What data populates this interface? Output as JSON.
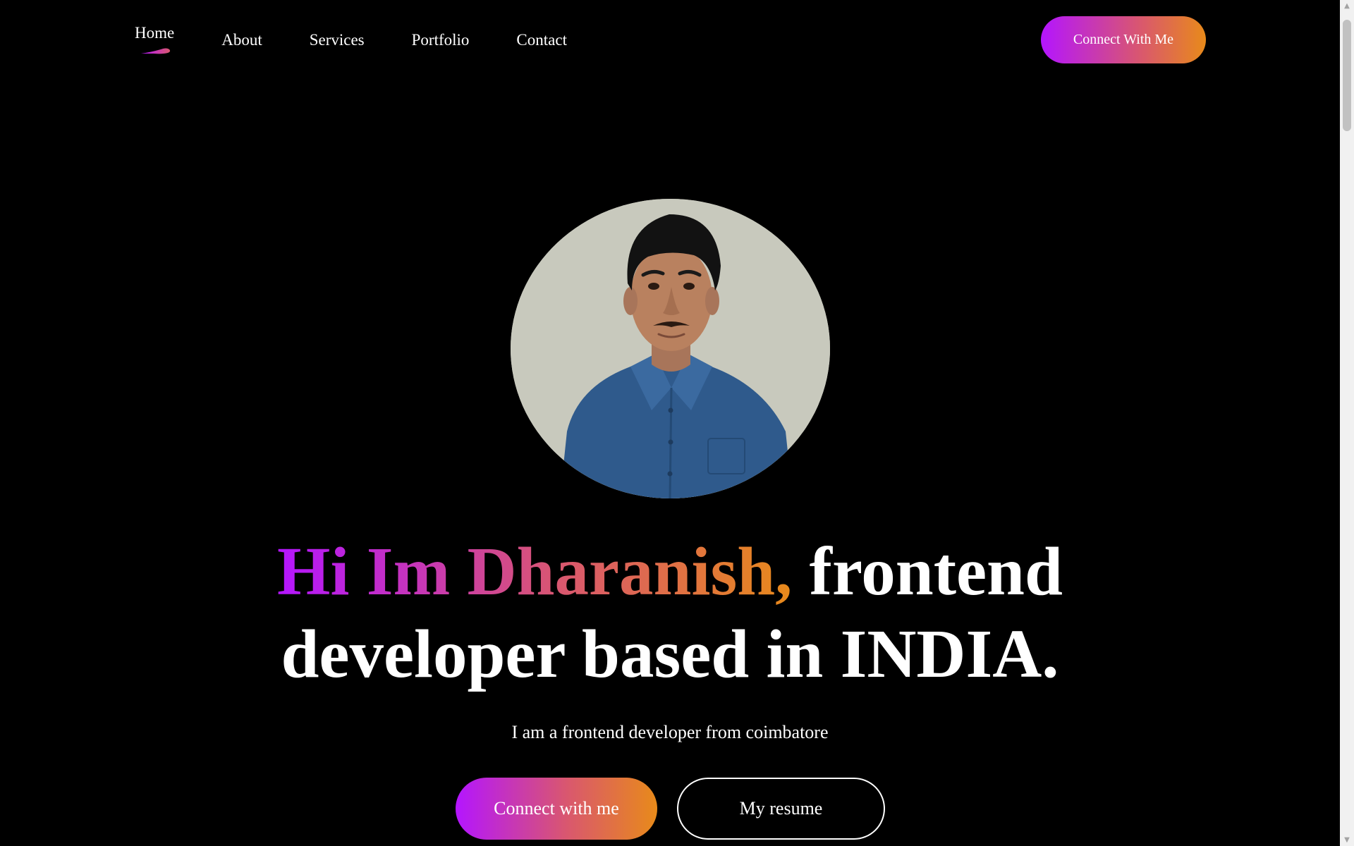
{
  "nav": {
    "items": [
      {
        "label": "Home",
        "active": true
      },
      {
        "label": "About"
      },
      {
        "label": "Services"
      },
      {
        "label": "Portfolio"
      },
      {
        "label": "Contact"
      }
    ],
    "cta_label": "Connect With Me"
  },
  "hero": {
    "headline_highlight": "Hi Im Dharanish,",
    "headline_rest_line1": " frontend",
    "headline_line2": "developer based in INDIA.",
    "subtitle": "I am a frontend developer from coimbatore",
    "primary_button": "Connect with me",
    "secondary_button": "My resume"
  },
  "colors": {
    "background": "#000000",
    "gradient_start": "#b415ff",
    "gradient_mid": "#d9576f",
    "gradient_end": "#e88a1a",
    "photo_background": "#c8c9bd",
    "shirt": "#2f5a8c"
  },
  "icons": {
    "active_indicator": "brush-stroke-underline-icon",
    "scroll_up": "triangle-up-icon",
    "scroll_down": "triangle-down-icon"
  }
}
